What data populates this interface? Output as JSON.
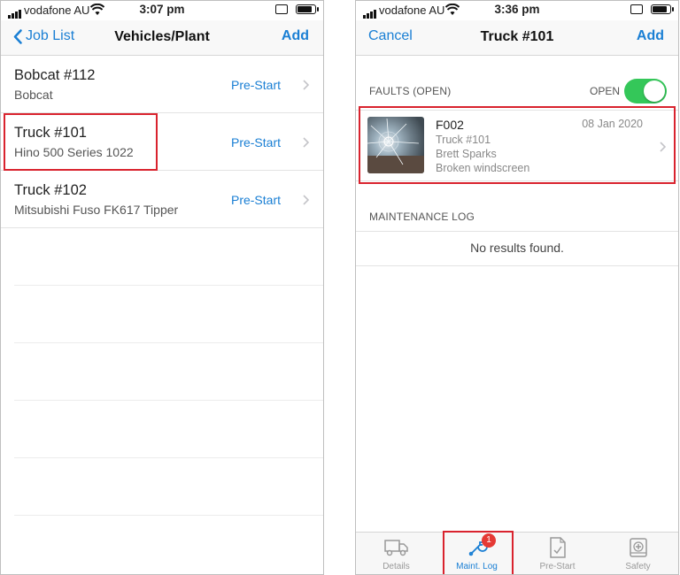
{
  "left": {
    "status": {
      "carrier": "vodafone AU",
      "time": "3:07 pm"
    },
    "nav": {
      "back_label": "Job List",
      "title": "Vehicles/Plant",
      "add_label": "Add"
    },
    "items": [
      {
        "title": "Bobcat #112",
        "subtitle": "Bobcat",
        "action": "Pre-Start"
      },
      {
        "title": "Truck #101",
        "subtitle": "Hino 500 Series 1022",
        "action": "Pre-Start"
      },
      {
        "title": "Truck #102",
        "subtitle": "Mitsubishi Fuso FK617 Tipper",
        "action": "Pre-Start"
      }
    ]
  },
  "right": {
    "status": {
      "carrier": "vodafone AU",
      "time": "3:36 pm"
    },
    "nav": {
      "cancel_label": "Cancel",
      "title": "Truck #101",
      "add_label": "Add"
    },
    "faults": {
      "header": "FAULTS (OPEN)",
      "toggle_label": "OPEN",
      "toggle_on": true,
      "items": [
        {
          "code": "F002",
          "date": "08 Jan 2020",
          "vehicle": "Truck #101",
          "person": "Brett Sparks",
          "description": "Broken windscreen"
        }
      ]
    },
    "maintenance": {
      "header": "MAINTENANCE LOG",
      "empty_text": "No results found."
    },
    "tabs": [
      {
        "label": "Details",
        "icon": "truck-icon"
      },
      {
        "label": "Maint. Log",
        "icon": "wrench-icon",
        "badge": "1",
        "active": true
      },
      {
        "label": "Pre-Start",
        "icon": "checklist-document-icon"
      },
      {
        "label": "Safety",
        "icon": "first-aid-icon"
      }
    ]
  },
  "colors": {
    "accent": "#1a7fd4",
    "highlight": "#d9232e",
    "toggle_on": "#34c759",
    "badge": "#e53935"
  }
}
